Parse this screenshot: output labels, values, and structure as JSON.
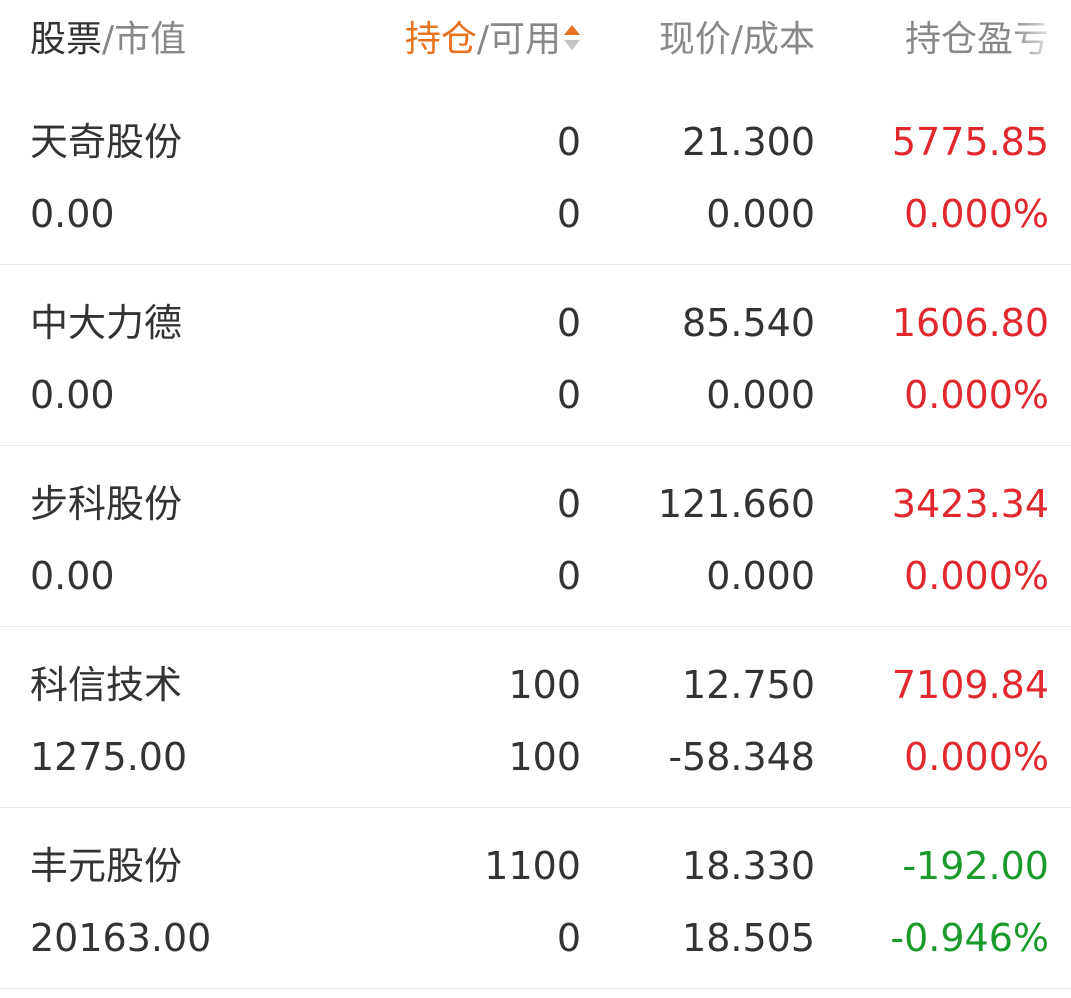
{
  "header": {
    "name_label": "股票",
    "value_label": "/市值",
    "hold_label": "持仓",
    "avail_label": "/可用",
    "price_label": "现价/成本",
    "pl_label": "持仓盈亏"
  },
  "colors": {
    "accent": "#e8731e",
    "gain": "#e0282e",
    "loss": "#1a9a2a",
    "text": "#333333",
    "muted": "#888888"
  },
  "rows": [
    {
      "name": "天奇股份",
      "market_value": "0.00",
      "hold": "0",
      "available": "0",
      "price": "21.300",
      "cost": "0.000",
      "pl": "5775.85",
      "pl_pct": "0.000%",
      "trend": "gain"
    },
    {
      "name": "中大力德",
      "market_value": "0.00",
      "hold": "0",
      "available": "0",
      "price": "85.540",
      "cost": "0.000",
      "pl": "1606.80",
      "pl_pct": "0.000%",
      "trend": "gain"
    },
    {
      "name": "步科股份",
      "market_value": "0.00",
      "hold": "0",
      "available": "0",
      "price": "121.660",
      "cost": "0.000",
      "pl": "3423.34",
      "pl_pct": "0.000%",
      "trend": "gain"
    },
    {
      "name": "科信技术",
      "market_value": "1275.00",
      "hold": "100",
      "available": "100",
      "price": "12.750",
      "cost": "-58.348",
      "pl": "7109.84",
      "pl_pct": "0.000%",
      "trend": "gain"
    },
    {
      "name": "丰元股份",
      "market_value": "20163.00",
      "hold": "1100",
      "available": "0",
      "price": "18.330",
      "cost": "18.505",
      "pl": "-192.00",
      "pl_pct": "-0.946%",
      "trend": "loss"
    }
  ]
}
